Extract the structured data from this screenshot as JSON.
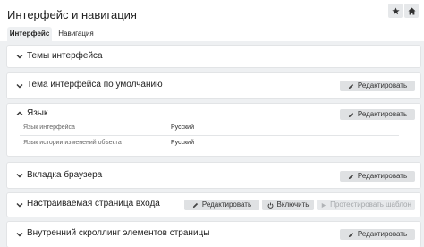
{
  "header": {
    "title": "Интерфейс и навигация",
    "tabs": [
      {
        "label": "Интерфейс",
        "active": true
      },
      {
        "label": "Навигация",
        "active": false
      }
    ]
  },
  "panels": {
    "themes": {
      "title": "Темы интерфейса"
    },
    "default_theme": {
      "title": "Тема интерфейса по умолчанию",
      "edit_label": "Редактировать"
    },
    "language": {
      "title": "Язык",
      "edit_label": "Редактировать",
      "rows": [
        {
          "label": "Язык интерфейса",
          "value": "Русский"
        },
        {
          "label": "Язык истории изменений объекта",
          "value": "Русский"
        }
      ]
    },
    "browser_tab": {
      "title": "Вкладка браузера",
      "edit_label": "Редактировать"
    },
    "login_page": {
      "title": "Настраиваемая страница входа",
      "edit_label": "Редактировать",
      "enable_label": "Включить",
      "test_label": "Протестировать шаблон"
    },
    "inner_scroll": {
      "title": "Внутренний скроллинг элементов страницы",
      "edit_label": "Редактировать"
    }
  },
  "colors": {
    "background": "#eef0f2",
    "panel": "#ffffff",
    "button": "#dfe1e3",
    "text": "#222222"
  },
  "icons": [
    "star-icon",
    "home-icon",
    "chevron-down-icon",
    "chevron-up-icon",
    "pencil-icon",
    "power-icon",
    "play-icon"
  ]
}
